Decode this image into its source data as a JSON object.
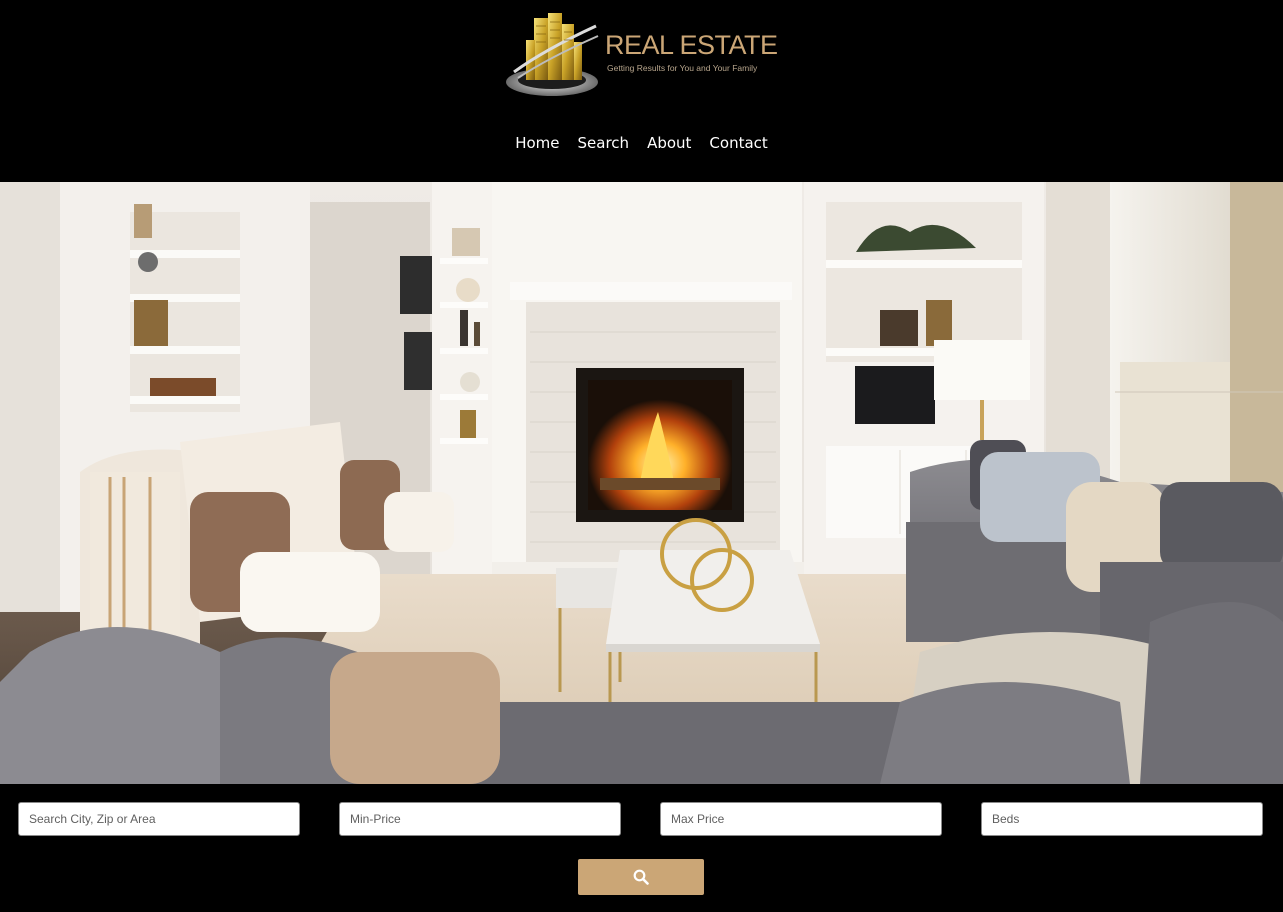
{
  "header": {
    "logo": {
      "title": "REAL ESTATE",
      "tagline": "Getting Results for You and Your Family",
      "icon": "gold-building-logo",
      "title_color": "#cba676"
    }
  },
  "nav": {
    "items": [
      {
        "label": "Home"
      },
      {
        "label": "Search"
      },
      {
        "label": "About"
      },
      {
        "label": "Contact"
      }
    ]
  },
  "hero": {
    "image": "living-room-photo"
  },
  "search": {
    "location_placeholder": "Search City, Zip or Area",
    "min_price_placeholder": "Min-Price",
    "max_price_placeholder": "Max Price",
    "beds_placeholder": "Beds",
    "submit_icon": "search-icon",
    "button_color": "#cba676"
  }
}
